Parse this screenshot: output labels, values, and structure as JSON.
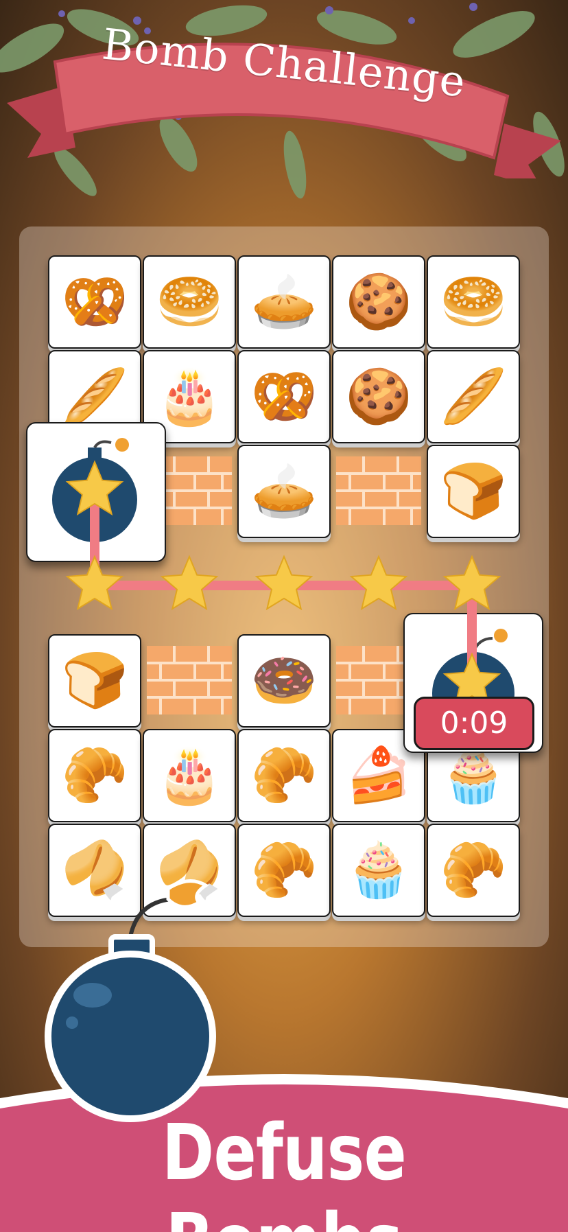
{
  "header": {
    "title": "Bomb Challenge"
  },
  "board": {
    "rows": [
      {
        "tiles": [
          "🥨",
          "🥯",
          "🥧",
          "🍪",
          "🥯"
        ]
      },
      {
        "tiles": [
          "🥖",
          "🎂",
          "🥨",
          "🍪",
          "🥖"
        ]
      },
      {
        "tiles": [
          "bomb",
          "wall",
          "🥧",
          "wall",
          "🍞"
        ]
      },
      {
        "tiles": [
          "star",
          "star",
          "star",
          "star",
          "star"
        ]
      },
      {
        "tiles": [
          "🍞",
          "wall",
          "🍩",
          "wall",
          "bomb"
        ]
      },
      {
        "tiles": [
          "🥐",
          "🎂",
          "🥐",
          "🍰",
          "🧁"
        ]
      },
      {
        "tiles": [
          "🥠",
          "🥠",
          "🥐",
          "🧁",
          "🥐"
        ]
      }
    ]
  },
  "timer": {
    "value": "0:09"
  },
  "footer": {
    "title": "Defuse Bombs"
  },
  "colors": {
    "banner": "#d9606a",
    "footer": "#cf4f76",
    "bomb": "#1f4a6e",
    "star": "#f7c948",
    "path": "#f07c84",
    "wall": "#f5a86a"
  }
}
